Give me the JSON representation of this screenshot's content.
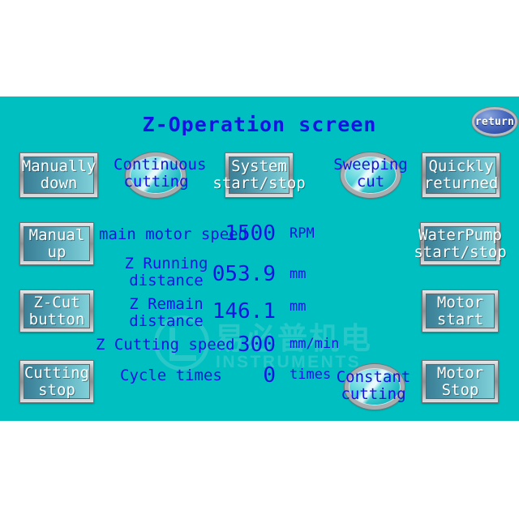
{
  "screen": {
    "title": "Z-Operation screen",
    "background_color": "#00bfc0",
    "text_color": "#1414e0"
  },
  "watermark": {
    "cn": "易必普机电",
    "en": "INSTRUMENTS"
  },
  "nav": {
    "return_label": "return"
  },
  "buttons": {
    "manually_down": "Manually\ndown",
    "manually_down_l1": "Manually",
    "manually_down_l2": "down",
    "system_start_stop_l1": "System",
    "system_start_stop_l2": "start/stop",
    "quickly_returned_l1": "Quickly",
    "quickly_returned_l2": "returned",
    "manual_up_l1": "Manual",
    "manual_up_l2": "up",
    "waterpump_l1": "WaterPump",
    "waterpump_l2": "start/stop",
    "z_cut_l1": "Z-Cut",
    "z_cut_l2": "button",
    "motor_start_l1": "Motor",
    "motor_start_l2": "start",
    "cutting_stop_l1": "Cutting",
    "cutting_stop_l2": "stop",
    "motor_stop_l1": "Motor",
    "motor_stop_l2": "Stop"
  },
  "indicators": {
    "continuous_cutting_l1": "Continuous",
    "continuous_cutting_l2": "cutting",
    "sweeping_cut_l1": "Sweeping",
    "sweeping_cut_l2": "cut",
    "constant_cutting_l1": "Constant",
    "constant_cutting_l2": "cutting"
  },
  "readouts": [
    {
      "label": "main motor speed",
      "label_l1": "main motor speed",
      "label_l2": "",
      "value": "1500",
      "unit": "RPM"
    },
    {
      "label": "Z Running distance",
      "label_l1": "Z Running",
      "label_l2": "distance",
      "value": "053.9",
      "unit": "mm"
    },
    {
      "label": "Z Remain distance",
      "label_l1": "Z Remain",
      "label_l2": "distance",
      "value": "146.1",
      "unit": "mm"
    },
    {
      "label": "Z Cutting speed",
      "label_l1": "Z Cutting speed",
      "label_l2": "",
      "value": "300",
      "unit": "mm/min"
    },
    {
      "label": "Cycle times",
      "label_l1": "Cycle times",
      "label_l2": "",
      "value": "0",
      "unit": "times"
    }
  ]
}
